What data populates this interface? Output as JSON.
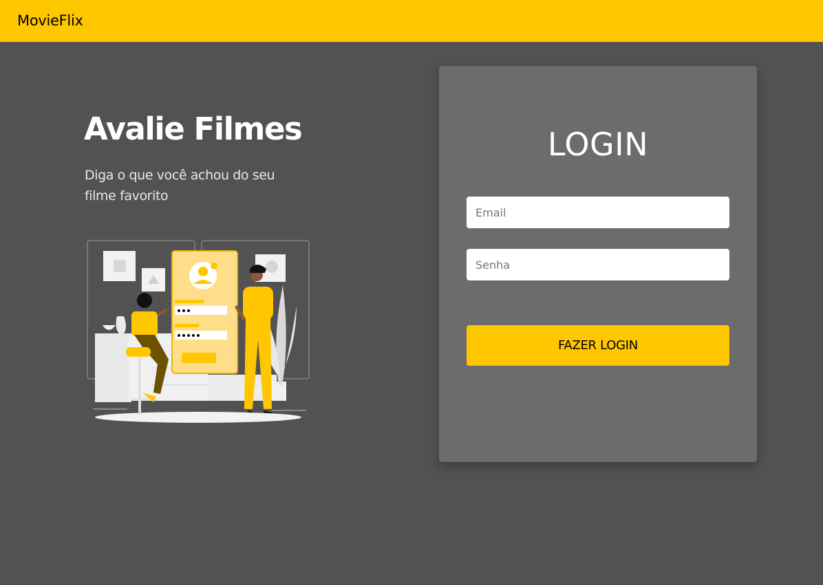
{
  "navbar": {
    "brand": "MovieFlix",
    "color": "#FFC700"
  },
  "hero": {
    "title": "Avalie Filmes",
    "subtitle": "Diga o que você achou do seu filme favorito",
    "illustration_icon": "login-illustration"
  },
  "login": {
    "title": "LOGIN",
    "email_placeholder": "Email",
    "email_value": "",
    "password_placeholder": "Senha",
    "password_value": "",
    "submit_label": "FAZER LOGIN"
  },
  "colors": {
    "background": "#525252",
    "card": "#6C6C6C",
    "accent": "#FFC700"
  }
}
